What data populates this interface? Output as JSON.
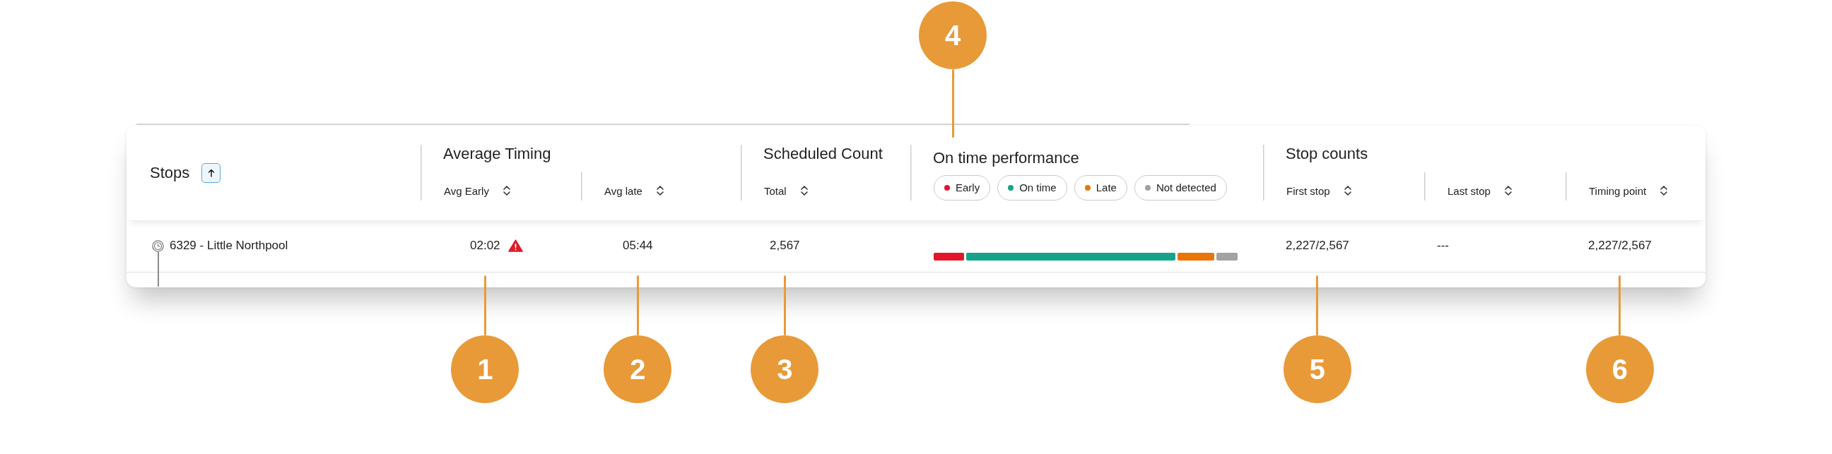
{
  "table": {
    "stops_column": {
      "label": "Stops",
      "sorted": true
    },
    "column_groups": [
      {
        "kind": "columns",
        "title": "Average Timing",
        "columns": [
          {
            "label": "Avg Early",
            "sorted": false
          },
          {
            "label": "Avg late",
            "sorted": false
          }
        ]
      },
      {
        "kind": "columns",
        "title": "Scheduled Count",
        "columns": [
          {
            "label": "Total",
            "sorted": false
          }
        ]
      },
      {
        "kind": "legend",
        "title": "On time performance",
        "callout": "4",
        "legend": [
          {
            "label": "Early",
            "color": "#e2162b"
          },
          {
            "label": "On time",
            "color": "#17a389"
          },
          {
            "label": "Late",
            "color": "#eb7409"
          },
          {
            "label": "Not detected",
            "color": "#a2a2a2"
          }
        ]
      },
      {
        "kind": "columns",
        "title": "Stop counts",
        "columns": [
          {
            "label": "First stop",
            "sorted": false
          },
          {
            "label": "Last stop",
            "sorted": false
          },
          {
            "label": "Timing point",
            "sorted": false
          }
        ]
      }
    ],
    "rows": [
      {
        "stop": "6329 - Little Northpool",
        "cells": [
          {
            "kind": "text",
            "value": "02:02",
            "warning": true,
            "callout": "1"
          },
          {
            "kind": "text",
            "value": "05:44",
            "warning": false,
            "callout": "2"
          },
          {
            "kind": "text",
            "value": "2,567",
            "warning": false,
            "callout": "3"
          },
          {
            "kind": "bar"
          },
          {
            "kind": "text",
            "value": "2,227/2,567",
            "warning": false,
            "callout": "5"
          },
          {
            "kind": "text",
            "value": "---",
            "warning": false
          },
          {
            "kind": "text",
            "value": "2,227/2,567",
            "warning": false,
            "callout": "6"
          }
        ]
      }
    ]
  }
}
